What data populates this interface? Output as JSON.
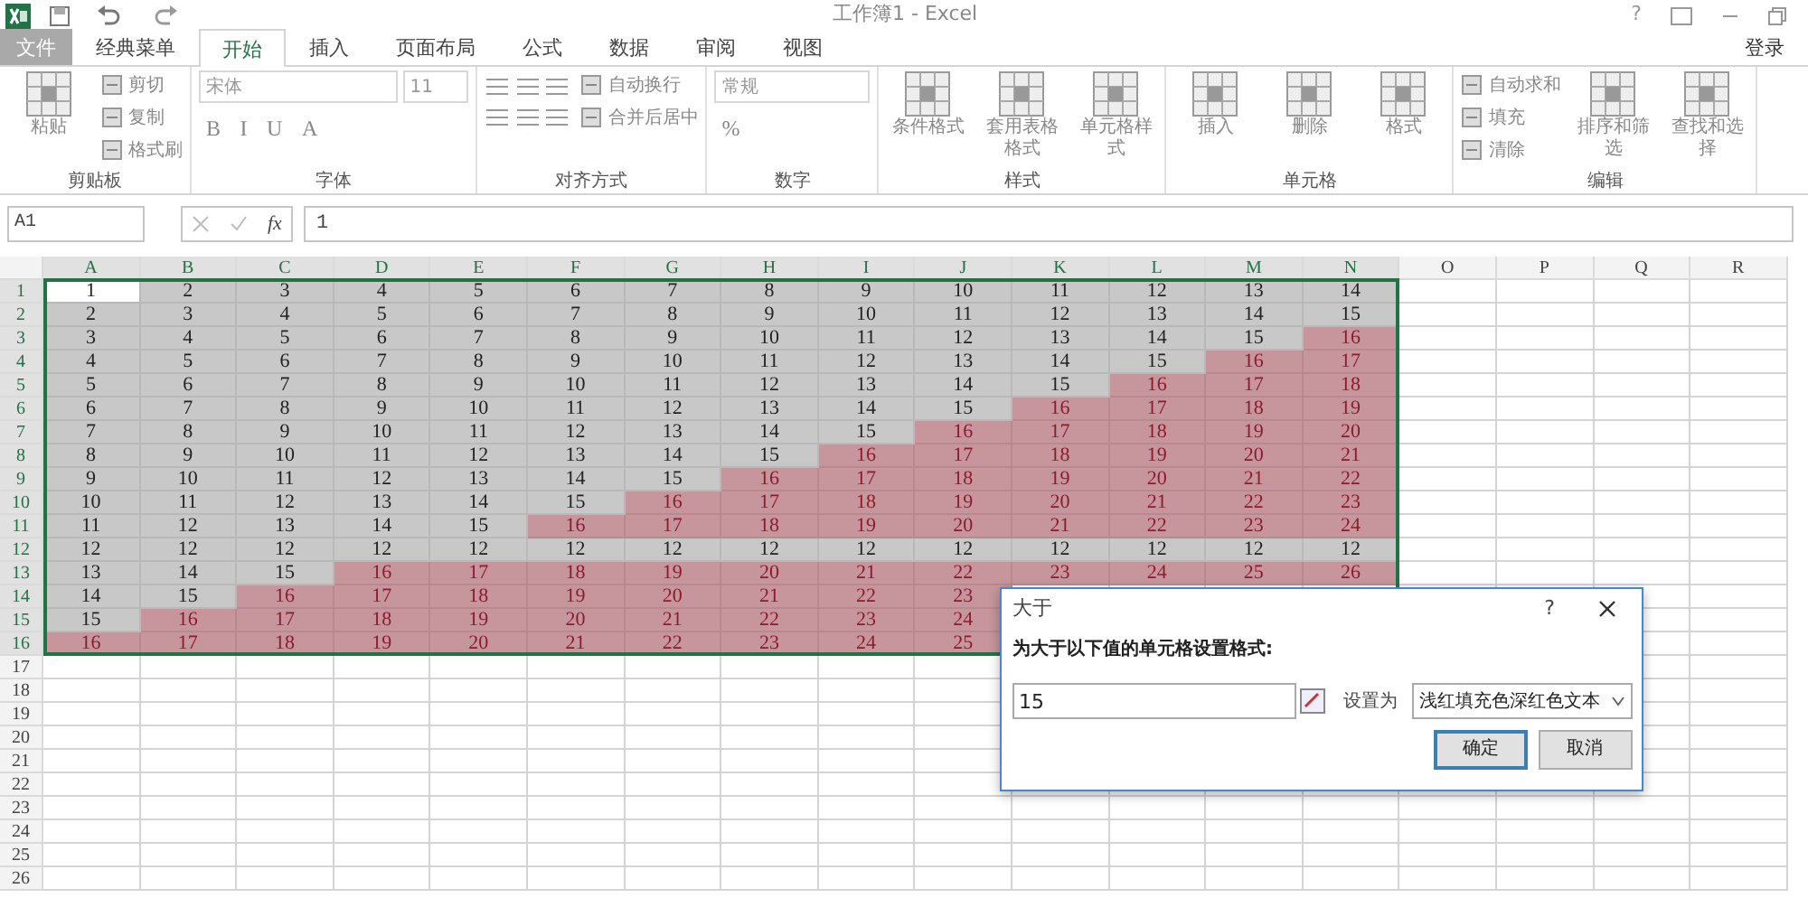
{
  "window": {
    "title": "工作簿1 - Excel",
    "help": "?"
  },
  "tabs": [
    {
      "label": "文件",
      "selected": false,
      "kind": "file"
    },
    {
      "label": "经典菜单",
      "selected": false,
      "kind": "tab"
    },
    {
      "label": "开始",
      "selected": true,
      "kind": "tab"
    },
    {
      "label": "插入",
      "selected": false,
      "kind": "tab"
    },
    {
      "label": "页面布局",
      "selected": false,
      "kind": "tab"
    },
    {
      "label": "公式",
      "selected": false,
      "kind": "tab"
    },
    {
      "label": "数据",
      "selected": false,
      "kind": "tab"
    },
    {
      "label": "审阅",
      "selected": false,
      "kind": "tab"
    },
    {
      "label": "视图",
      "selected": false,
      "kind": "tab"
    }
  ],
  "account": "登录",
  "ribbon_groups": [
    {
      "label": "剪贴板",
      "columns": [
        [
          {
            "kind": "large",
            "label": "粘贴"
          }
        ],
        [
          {
            "kind": "small",
            "label": "剪切"
          },
          {
            "kind": "small",
            "label": "复制"
          },
          {
            "kind": "small",
            "label": "格式刷"
          }
        ]
      ]
    },
    {
      "label": "字体",
      "columns": [
        [
          {
            "kind": "fields",
            "values": [
              "宋体",
              "11"
            ]
          },
          {
            "kind": "glyphs",
            "glyphs": [
              "B",
              "I",
              "U",
              "A"
            ]
          }
        ]
      ]
    },
    {
      "label": "对齐方式",
      "columns": [
        [
          {
            "kind": "icons"
          },
          {
            "kind": "icons"
          }
        ],
        [
          {
            "kind": "small",
            "label": "自动换行"
          },
          {
            "kind": "small",
            "label": "合并后居中"
          }
        ]
      ]
    },
    {
      "label": "数字",
      "columns": [
        [
          {
            "kind": "fields",
            "values": [
              "常规"
            ]
          },
          {
            "kind": "glyphs",
            "glyphs": [
              "%"
            ]
          }
        ]
      ]
    },
    {
      "label": "样式",
      "columns": [
        [
          {
            "kind": "large",
            "label": "条件格式"
          }
        ],
        [
          {
            "kind": "large",
            "label": "套用表格格式"
          }
        ],
        [
          {
            "kind": "large",
            "label": "单元格样式"
          }
        ]
      ]
    },
    {
      "label": "单元格",
      "columns": [
        [
          {
            "kind": "large",
            "label": "插入"
          }
        ],
        [
          {
            "kind": "large",
            "label": "删除"
          }
        ],
        [
          {
            "kind": "large",
            "label": "格式"
          }
        ]
      ]
    },
    {
      "label": "编辑",
      "columns": [
        [
          {
            "kind": "small",
            "label": "自动求和"
          },
          {
            "kind": "small",
            "label": "填充"
          },
          {
            "kind": "small",
            "label": "清除"
          }
        ],
        [
          {
            "kind": "large",
            "label": "排序和筛选"
          }
        ],
        [
          {
            "kind": "large",
            "label": "查找和选择"
          }
        ]
      ]
    }
  ],
  "formula_bar": {
    "name_box": "A1",
    "fx": "fx",
    "formula": "1"
  },
  "columns": [
    {
      "label": "A",
      "selected": true
    },
    {
      "label": "B",
      "selected": true
    },
    {
      "label": "C",
      "selected": true
    },
    {
      "label": "D",
      "selected": true
    },
    {
      "label": "E",
      "selected": true
    },
    {
      "label": "F",
      "selected": true
    },
    {
      "label": "G",
      "selected": true
    },
    {
      "label": "H",
      "selected": true
    },
    {
      "label": "I",
      "selected": true
    },
    {
      "label": "J",
      "selected": true
    },
    {
      "label": "K",
      "selected": true
    },
    {
      "label": "L",
      "selected": true
    },
    {
      "label": "M",
      "selected": true
    },
    {
      "label": "N",
      "selected": true
    },
    {
      "label": "O",
      "selected": false
    },
    {
      "label": "P",
      "selected": false
    },
    {
      "label": "Q",
      "selected": false
    },
    {
      "label": "R",
      "selected": false
    }
  ],
  "rows": [
    {
      "header": "1",
      "selected": true,
      "cells": [
        {
          "text": "1",
          "highlighted": false,
          "selected": true
        },
        {
          "text": "2",
          "highlighted": false,
          "selected": false
        },
        {
          "text": "3",
          "highlighted": false,
          "selected": false
        },
        {
          "text": "4",
          "highlighted": false,
          "selected": false
        },
        {
          "text": "5",
          "highlighted": false,
          "selected": false
        },
        {
          "text": "6",
          "highlighted": false,
          "selected": false
        },
        {
          "text": "7",
          "highlighted": false,
          "selected": false
        },
        {
          "text": "8",
          "highlighted": false,
          "selected": false
        },
        {
          "text": "9",
          "highlighted": false,
          "selected": false
        },
        {
          "text": "10",
          "highlighted": false,
          "selected": false
        },
        {
          "text": "11",
          "highlighted": false,
          "selected": false
        },
        {
          "text": "12",
          "highlighted": false,
          "selected": false
        },
        {
          "text": "13",
          "highlighted": false,
          "selected": false
        },
        {
          "text": "14",
          "highlighted": false,
          "selected": false
        }
      ]
    },
    {
      "header": "2",
      "selected": true,
      "cells": [
        {
          "text": "2",
          "highlighted": false,
          "selected": false
        },
        {
          "text": "3",
          "highlighted": false,
          "selected": false
        },
        {
          "text": "4",
          "highlighted": false,
          "selected": false
        },
        {
          "text": "5",
          "highlighted": false,
          "selected": false
        },
        {
          "text": "6",
          "highlighted": false,
          "selected": false
        },
        {
          "text": "7",
          "highlighted": false,
          "selected": false
        },
        {
          "text": "8",
          "highlighted": false,
          "selected": false
        },
        {
          "text": "9",
          "highlighted": false,
          "selected": false
        },
        {
          "text": "10",
          "highlighted": false,
          "selected": false
        },
        {
          "text": "11",
          "highlighted": false,
          "selected": false
        },
        {
          "text": "12",
          "highlighted": false,
          "selected": false
        },
        {
          "text": "13",
          "highlighted": false,
          "selected": false
        },
        {
          "text": "14",
          "highlighted": false,
          "selected": false
        },
        {
          "text": "15",
          "highlighted": false,
          "selected": false
        }
      ]
    },
    {
      "header": "3",
      "selected": true,
      "cells": [
        {
          "text": "3",
          "highlighted": false,
          "selected": false
        },
        {
          "text": "4",
          "highlighted": false,
          "selected": false
        },
        {
          "text": "5",
          "highlighted": false,
          "selected": false
        },
        {
          "text": "6",
          "highlighted": false,
          "selected": false
        },
        {
          "text": "7",
          "highlighted": false,
          "selected": false
        },
        {
          "text": "8",
          "highlighted": false,
          "selected": false
        },
        {
          "text": "9",
          "highlighted": false,
          "selected": false
        },
        {
          "text": "10",
          "highlighted": false,
          "selected": false
        },
        {
          "text": "11",
          "highlighted": false,
          "selected": false
        },
        {
          "text": "12",
          "highlighted": false,
          "selected": false
        },
        {
          "text": "13",
          "highlighted": false,
          "selected": false
        },
        {
          "text": "14",
          "highlighted": false,
          "selected": false
        },
        {
          "text": "15",
          "highlighted": false,
          "selected": false
        },
        {
          "text": "16",
          "highlighted": true,
          "selected": false
        }
      ]
    },
    {
      "header": "4",
      "selected": true,
      "cells": [
        {
          "text": "4",
          "highlighted": false,
          "selected": false
        },
        {
          "text": "5",
          "highlighted": false,
          "selected": false
        },
        {
          "text": "6",
          "highlighted": false,
          "selected": false
        },
        {
          "text": "7",
          "highlighted": false,
          "selected": false
        },
        {
          "text": "8",
          "highlighted": false,
          "selected": false
        },
        {
          "text": "9",
          "highlighted": false,
          "selected": false
        },
        {
          "text": "10",
          "highlighted": false,
          "selected": false
        },
        {
          "text": "11",
          "highlighted": false,
          "selected": false
        },
        {
          "text": "12",
          "highlighted": false,
          "selected": false
        },
        {
          "text": "13",
          "highlighted": false,
          "selected": false
        },
        {
          "text": "14",
          "highlighted": false,
          "selected": false
        },
        {
          "text": "15",
          "highlighted": false,
          "selected": false
        },
        {
          "text": "16",
          "highlighted": true,
          "selected": false
        },
        {
          "text": "17",
          "highlighted": true,
          "selected": false
        }
      ]
    },
    {
      "header": "5",
      "selected": true,
      "cells": [
        {
          "text": "5",
          "highlighted": false,
          "selected": false
        },
        {
          "text": "6",
          "highlighted": false,
          "selected": false
        },
        {
          "text": "7",
          "highlighted": false,
          "selected": false
        },
        {
          "text": "8",
          "highlighted": false,
          "selected": false
        },
        {
          "text": "9",
          "highlighted": false,
          "selected": false
        },
        {
          "text": "10",
          "highlighted": false,
          "selected": false
        },
        {
          "text": "11",
          "highlighted": false,
          "selected": false
        },
        {
          "text": "12",
          "highlighted": false,
          "selected": false
        },
        {
          "text": "13",
          "highlighted": false,
          "selected": false
        },
        {
          "text": "14",
          "highlighted": false,
          "selected": false
        },
        {
          "text": "15",
          "highlighted": false,
          "selected": false
        },
        {
          "text": "16",
          "highlighted": true,
          "selected": false
        },
        {
          "text": "17",
          "highlighted": true,
          "selected": false
        },
        {
          "text": "18",
          "highlighted": true,
          "selected": false
        }
      ]
    },
    {
      "header": "6",
      "selected": true,
      "cells": [
        {
          "text": "6",
          "highlighted": false,
          "selected": false
        },
        {
          "text": "7",
          "highlighted": false,
          "selected": false
        },
        {
          "text": "8",
          "highlighted": false,
          "selected": false
        },
        {
          "text": "9",
          "highlighted": false,
          "selected": false
        },
        {
          "text": "10",
          "highlighted": false,
          "selected": false
        },
        {
          "text": "11",
          "highlighted": false,
          "selected": false
        },
        {
          "text": "12",
          "highlighted": false,
          "selected": false
        },
        {
          "text": "13",
          "highlighted": false,
          "selected": false
        },
        {
          "text": "14",
          "highlighted": false,
          "selected": false
        },
        {
          "text": "15",
          "highlighted": false,
          "selected": false
        },
        {
          "text": "16",
          "highlighted": true,
          "selected": false
        },
        {
          "text": "17",
          "highlighted": true,
          "selected": false
        },
        {
          "text": "18",
          "highlighted": true,
          "selected": false
        },
        {
          "text": "19",
          "highlighted": true,
          "selected": false
        }
      ]
    },
    {
      "header": "7",
      "selected": true,
      "cells": [
        {
          "text": "7",
          "highlighted": false,
          "selected": false
        },
        {
          "text": "8",
          "highlighted": false,
          "selected": false
        },
        {
          "text": "9",
          "highlighted": false,
          "selected": false
        },
        {
          "text": "10",
          "highlighted": false,
          "selected": false
        },
        {
          "text": "11",
          "highlighted": false,
          "selected": false
        },
        {
          "text": "12",
          "highlighted": false,
          "selected": false
        },
        {
          "text": "13",
          "highlighted": false,
          "selected": false
        },
        {
          "text": "14",
          "highlighted": false,
          "selected": false
        },
        {
          "text": "15",
          "highlighted": false,
          "selected": false
        },
        {
          "text": "16",
          "highlighted": true,
          "selected": false
        },
        {
          "text": "17",
          "highlighted": true,
          "selected": false
        },
        {
          "text": "18",
          "highlighted": true,
          "selected": false
        },
        {
          "text": "19",
          "highlighted": true,
          "selected": false
        },
        {
          "text": "20",
          "highlighted": true,
          "selected": false
        }
      ]
    },
    {
      "header": "8",
      "selected": true,
      "cells": [
        {
          "text": "8",
          "highlighted": false,
          "selected": false
        },
        {
          "text": "9",
          "highlighted": false,
          "selected": false
        },
        {
          "text": "10",
          "highlighted": false,
          "selected": false
        },
        {
          "text": "11",
          "highlighted": false,
          "selected": false
        },
        {
          "text": "12",
          "highlighted": false,
          "selected": false
        },
        {
          "text": "13",
          "highlighted": false,
          "selected": false
        },
        {
          "text": "14",
          "highlighted": false,
          "selected": false
        },
        {
          "text": "15",
          "highlighted": false,
          "selected": false
        },
        {
          "text": "16",
          "highlighted": true,
          "selected": false
        },
        {
          "text": "17",
          "highlighted": true,
          "selected": false
        },
        {
          "text": "18",
          "highlighted": true,
          "selected": false
        },
        {
          "text": "19",
          "highlighted": true,
          "selected": false
        },
        {
          "text": "20",
          "highlighted": true,
          "selected": false
        },
        {
          "text": "21",
          "highlighted": true,
          "selected": false
        }
      ]
    },
    {
      "header": "9",
      "selected": true,
      "cells": [
        {
          "text": "9",
          "highlighted": false,
          "selected": false
        },
        {
          "text": "10",
          "highlighted": false,
          "selected": false
        },
        {
          "text": "11",
          "highlighted": false,
          "selected": false
        },
        {
          "text": "12",
          "highlighted": false,
          "selected": false
        },
        {
          "text": "13",
          "highlighted": false,
          "selected": false
        },
        {
          "text": "14",
          "highlighted": false,
          "selected": false
        },
        {
          "text": "15",
          "highlighted": false,
          "selected": false
        },
        {
          "text": "16",
          "highlighted": true,
          "selected": false
        },
        {
          "text": "17",
          "highlighted": true,
          "selected": false
        },
        {
          "text": "18",
          "highlighted": true,
          "selected": false
        },
        {
          "text": "19",
          "highlighted": true,
          "selected": false
        },
        {
          "text": "20",
          "highlighted": true,
          "selected": false
        },
        {
          "text": "21",
          "highlighted": true,
          "selected": false
        },
        {
          "text": "22",
          "highlighted": true,
          "selected": false
        }
      ]
    },
    {
      "header": "10",
      "selected": true,
      "cells": [
        {
          "text": "10",
          "highlighted": false,
          "selected": false
        },
        {
          "text": "11",
          "highlighted": false,
          "selected": false
        },
        {
          "text": "12",
          "highlighted": false,
          "selected": false
        },
        {
          "text": "13",
          "highlighted": false,
          "selected": false
        },
        {
          "text": "14",
          "highlighted": false,
          "selected": false
        },
        {
          "text": "15",
          "highlighted": false,
          "selected": false
        },
        {
          "text": "16",
          "highlighted": true,
          "selected": false
        },
        {
          "text": "17",
          "highlighted": true,
          "selected": false
        },
        {
          "text": "18",
          "highlighted": true,
          "selected": false
        },
        {
          "text": "19",
          "highlighted": true,
          "selected": false
        },
        {
          "text": "20",
          "highlighted": true,
          "selected": false
        },
        {
          "text": "21",
          "highlighted": true,
          "selected": false
        },
        {
          "text": "22",
          "highlighted": true,
          "selected": false
        },
        {
          "text": "23",
          "highlighted": true,
          "selected": false
        }
      ]
    },
    {
      "header": "11",
      "selected": true,
      "cells": [
        {
          "text": "11",
          "highlighted": false,
          "selected": false
        },
        {
          "text": "12",
          "highlighted": false,
          "selected": false
        },
        {
          "text": "13",
          "highlighted": false,
          "selected": false
        },
        {
          "text": "14",
          "highlighted": false,
          "selected": false
        },
        {
          "text": "15",
          "highlighted": false,
          "selected": false
        },
        {
          "text": "16",
          "highlighted": true,
          "selected": false
        },
        {
          "text": "17",
          "highlighted": true,
          "selected": false
        },
        {
          "text": "18",
          "highlighted": true,
          "selected": false
        },
        {
          "text": "19",
          "highlighted": true,
          "selected": false
        },
        {
          "text": "20",
          "highlighted": true,
          "selected": false
        },
        {
          "text": "21",
          "highlighted": true,
          "selected": false
        },
        {
          "text": "22",
          "highlighted": true,
          "selected": false
        },
        {
          "text": "23",
          "highlighted": true,
          "selected": false
        },
        {
          "text": "24",
          "highlighted": true,
          "selected": false
        }
      ]
    },
    {
      "header": "12",
      "selected": true,
      "cells": [
        {
          "text": "12",
          "highlighted": false,
          "selected": false
        },
        {
          "text": "12",
          "highlighted": false,
          "selected": false
        },
        {
          "text": "12",
          "highlighted": false,
          "selected": false
        },
        {
          "text": "12",
          "highlighted": false,
          "selected": false
        },
        {
          "text": "12",
          "highlighted": false,
          "selected": false
        },
        {
          "text": "12",
          "highlighted": false,
          "selected": false
        },
        {
          "text": "12",
          "highlighted": false,
          "selected": false
        },
        {
          "text": "12",
          "highlighted": false,
          "selected": false
        },
        {
          "text": "12",
          "highlighted": false,
          "selected": false
        },
        {
          "text": "12",
          "highlighted": false,
          "selected": false
        },
        {
          "text": "12",
          "highlighted": false,
          "selected": false
        },
        {
          "text": "12",
          "highlighted": false,
          "selected": false
        },
        {
          "text": "12",
          "highlighted": false,
          "selected": false
        },
        {
          "text": "12",
          "highlighted": false,
          "selected": false
        }
      ]
    },
    {
      "header": "13",
      "selected": true,
      "cells": [
        {
          "text": "13",
          "highlighted": false,
          "selected": false
        },
        {
          "text": "14",
          "highlighted": false,
          "selected": false
        },
        {
          "text": "15",
          "highlighted": false,
          "selected": false
        },
        {
          "text": "16",
          "highlighted": true,
          "selected": false
        },
        {
          "text": "17",
          "highlighted": true,
          "selected": false
        },
        {
          "text": "18",
          "highlighted": true,
          "selected": false
        },
        {
          "text": "19",
          "highlighted": true,
          "selected": false
        },
        {
          "text": "20",
          "highlighted": true,
          "selected": false
        },
        {
          "text": "21",
          "highlighted": true,
          "selected": false
        },
        {
          "text": "22",
          "highlighted": true,
          "selected": false
        },
        {
          "text": "23",
          "highlighted": true,
          "selected": false
        },
        {
          "text": "24",
          "highlighted": true,
          "selected": false
        },
        {
          "text": "25",
          "highlighted": true,
          "selected": false
        },
        {
          "text": "26",
          "highlighted": true,
          "selected": false
        }
      ]
    },
    {
      "header": "14",
      "selected": true,
      "cells": [
        {
          "text": "14",
          "highlighted": false,
          "selected": false
        },
        {
          "text": "15",
          "highlighted": false,
          "selected": false
        },
        {
          "text": "16",
          "highlighted": true,
          "selected": false
        },
        {
          "text": "17",
          "highlighted": true,
          "selected": false
        },
        {
          "text": "18",
          "highlighted": true,
          "selected": false
        },
        {
          "text": "19",
          "highlighted": true,
          "selected": false
        },
        {
          "text": "20",
          "highlighted": true,
          "selected": false
        },
        {
          "text": "21",
          "highlighted": true,
          "selected": false
        },
        {
          "text": "22",
          "highlighted": true,
          "selected": false
        },
        {
          "text": "23",
          "highlighted": true,
          "selected": false
        }
      ]
    },
    {
      "header": "15",
      "selected": true,
      "cells": [
        {
          "text": "15",
          "highlighted": false,
          "selected": false
        },
        {
          "text": "16",
          "highlighted": true,
          "selected": false
        },
        {
          "text": "17",
          "highlighted": true,
          "selected": false
        },
        {
          "text": "18",
          "highlighted": true,
          "selected": false
        },
        {
          "text": "19",
          "highlighted": true,
          "selected": false
        },
        {
          "text": "20",
          "highlighted": true,
          "selected": false
        },
        {
          "text": "21",
          "highlighted": true,
          "selected": false
        },
        {
          "text": "22",
          "highlighted": true,
          "selected": false
        },
        {
          "text": "23",
          "highlighted": true,
          "selected": false
        },
        {
          "text": "24",
          "highlighted": true,
          "selected": false
        }
      ]
    },
    {
      "header": "16",
      "selected": true,
      "cells": [
        {
          "text": "16",
          "highlighted": true,
          "selected": false
        },
        {
          "text": "17",
          "highlighted": true,
          "selected": false
        },
        {
          "text": "18",
          "highlighted": true,
          "selected": false
        },
        {
          "text": "19",
          "highlighted": true,
          "selected": false
        },
        {
          "text": "20",
          "highlighted": true,
          "selected": false
        },
        {
          "text": "21",
          "highlighted": true,
          "selected": false
        },
        {
          "text": "22",
          "highlighted": true,
          "selected": false
        },
        {
          "text": "23",
          "highlighted": true,
          "selected": false
        },
        {
          "text": "24",
          "highlighted": true,
          "selected": false
        },
        {
          "text": "25",
          "highlighted": true,
          "selected": false
        }
      ]
    },
    {
      "header": "17",
      "selected": false,
      "cells": []
    },
    {
      "header": "18",
      "selected": false,
      "cells": []
    },
    {
      "header": "19",
      "selected": false,
      "cells": []
    },
    {
      "header": "20",
      "selected": false,
      "cells": []
    },
    {
      "header": "21",
      "selected": false,
      "cells": []
    },
    {
      "header": "22",
      "selected": false,
      "cells": []
    },
    {
      "header": "23",
      "selected": false,
      "cells": []
    },
    {
      "header": "24",
      "selected": false,
      "cells": []
    },
    {
      "header": "25",
      "selected": false,
      "cells": []
    },
    {
      "header": "26",
      "selected": false,
      "cells": []
    }
  ],
  "dialog": {
    "title": "大于",
    "help": "?",
    "prompt": "为大于以下值的单元格设置格式:",
    "value": "15",
    "format_label": "设置为",
    "format": "浅红填充色深红色文本",
    "buttons": [
      {
        "label": "确定",
        "default": true
      },
      {
        "label": "取消",
        "default": false
      }
    ]
  }
}
